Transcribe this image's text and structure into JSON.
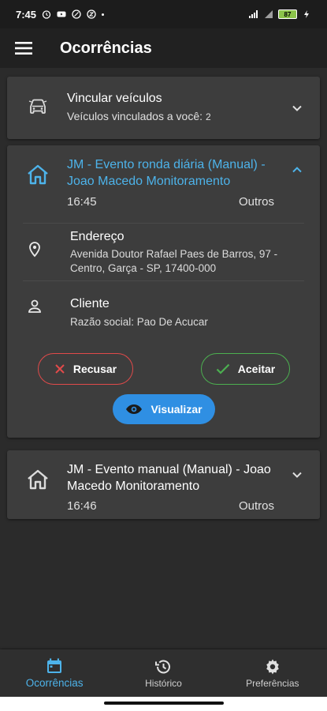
{
  "status_bar": {
    "time": "7:45",
    "battery": "87"
  },
  "app_bar": {
    "title": "Ocorrências"
  },
  "vinc_card": {
    "title": "Vincular veículos",
    "subtitle": "Veículos vinculados a você:",
    "count": "2"
  },
  "event1": {
    "title": "JM - Evento ronda diária (Manual) - Joao Macedo Monitoramento",
    "time": "16:45",
    "type": "Outros",
    "address_label": "Endereço",
    "address_value": " Avenida Doutor Rafael Paes de Barros, 97 - Centro, Garça - SP, 17400-000",
    "client_label": "Cliente",
    "client_value": "Razão social: Pao De Acucar",
    "refuse_label": "Recusar",
    "accept_label": "Aceitar",
    "view_label": "Visualizar"
  },
  "event2": {
    "title": "JM - Evento manual (Manual) - Joao Macedo Monitoramento",
    "time": "16:46",
    "type": "Outros"
  },
  "bottom_nav": {
    "items": [
      {
        "label": "Ocorrências",
        "icon": "calendar-icon",
        "active": true
      },
      {
        "label": "Histórico",
        "icon": "history-icon",
        "active": false
      },
      {
        "label": "Preferências",
        "icon": "gear-icon",
        "active": false
      }
    ]
  },
  "colors": {
    "accent": "#4db3ea",
    "refuse": "#e14a4a",
    "accept": "#4caf50",
    "view": "#2f8fe3"
  }
}
